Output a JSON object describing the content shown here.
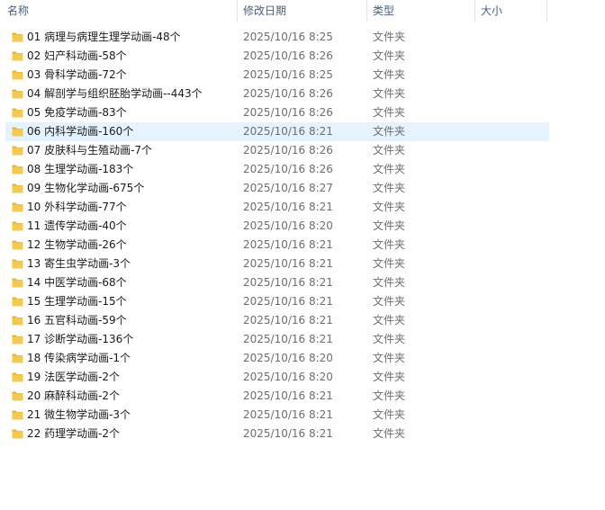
{
  "columns": {
    "name": "名称",
    "date": "修改日期",
    "type": "类型",
    "size": "大小"
  },
  "sort_indicator": "^",
  "selected_index": 5,
  "colors": {
    "folder": "#f4c94f",
    "folder_dark": "#e2b23a",
    "selection": "#e5f3ff"
  },
  "files": [
    {
      "name": "01 病理与病理生理学动画-48个",
      "date": "2025/10/16 8:25",
      "type": "文件夹"
    },
    {
      "name": "02 妇产科动画-58个",
      "date": "2025/10/16 8:26",
      "type": "文件夹"
    },
    {
      "name": "03 骨科学动画-72个",
      "date": "2025/10/16 8:25",
      "type": "文件夹"
    },
    {
      "name": "04 解剖学与组织胚胎学动画--443个",
      "date": "2025/10/16 8:26",
      "type": "文件夹"
    },
    {
      "name": "05 免疫学动画-83个",
      "date": "2025/10/16 8:26",
      "type": "文件夹"
    },
    {
      "name": "06 内科学动画-160个",
      "date": "2025/10/16 8:21",
      "type": "文件夹"
    },
    {
      "name": "07 皮肤科与生殖动画-7个",
      "date": "2025/10/16 8:26",
      "type": "文件夹"
    },
    {
      "name": "08 生理学动画-183个",
      "date": "2025/10/16 8:26",
      "type": "文件夹"
    },
    {
      "name": "09 生物化学动画-675个",
      "date": "2025/10/16 8:27",
      "type": "文件夹"
    },
    {
      "name": "10 外科学动画-77个",
      "date": "2025/10/16 8:21",
      "type": "文件夹"
    },
    {
      "name": "11 遗传学动画-40个",
      "date": "2025/10/16 8:20",
      "type": "文件夹"
    },
    {
      "name": "12 生物学动画-26个",
      "date": "2025/10/16 8:21",
      "type": "文件夹"
    },
    {
      "name": "13 寄生虫学动画-3个",
      "date": "2025/10/16 8:21",
      "type": "文件夹"
    },
    {
      "name": "14 中医学动画-68个",
      "date": "2025/10/16 8:21",
      "type": "文件夹"
    },
    {
      "name": "15 生理学动画-15个",
      "date": "2025/10/16 8:21",
      "type": "文件夹"
    },
    {
      "name": "16 五官科动画-59个",
      "date": "2025/10/16 8:21",
      "type": "文件夹"
    },
    {
      "name": "17 诊断学动画-136个",
      "date": "2025/10/16 8:21",
      "type": "文件夹"
    },
    {
      "name": "18 传染病学动画-1个",
      "date": "2025/10/16 8:20",
      "type": "文件夹"
    },
    {
      "name": "19 法医学动画-2个",
      "date": "2025/10/16 8:20",
      "type": "文件夹"
    },
    {
      "name": "20 麻醉科动画-2个",
      "date": "2025/10/16 8:21",
      "type": "文件夹"
    },
    {
      "name": "21 微生物学动画-3个",
      "date": "2025/10/16 8:21",
      "type": "文件夹"
    },
    {
      "name": "22 药理学动画-2个",
      "date": "2025/10/16 8:21",
      "type": "文件夹"
    }
  ]
}
